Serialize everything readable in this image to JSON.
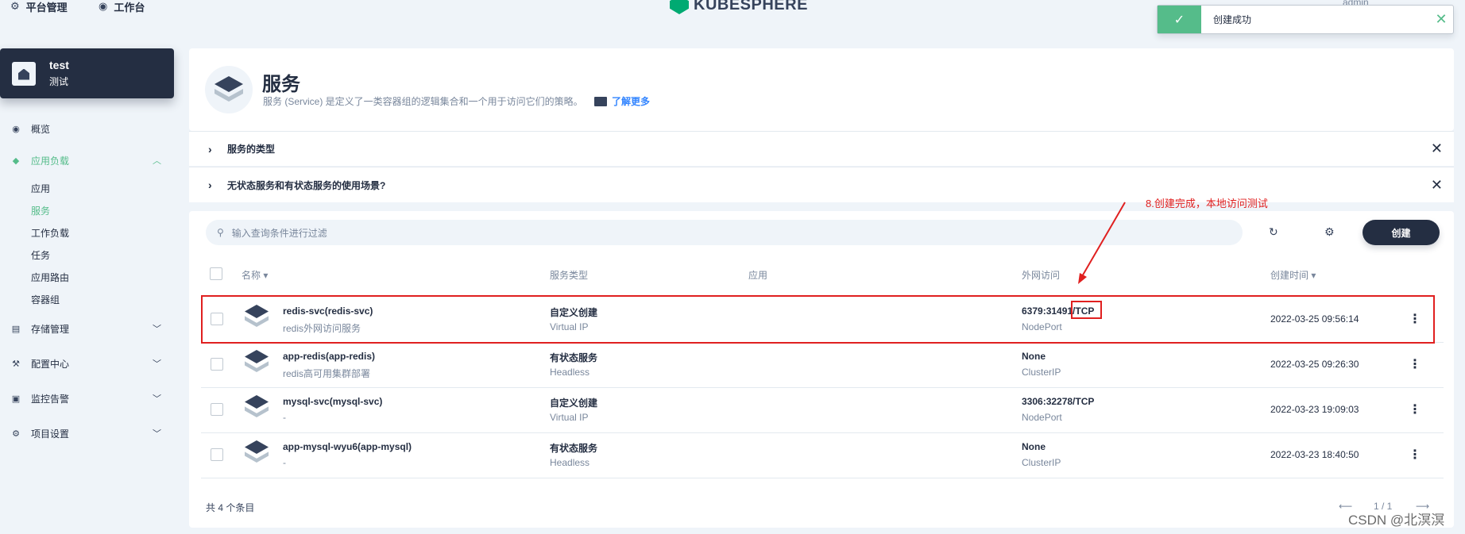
{
  "topbar": {
    "platform_label": "平台管理",
    "workbench_label": "工作台",
    "logo_text": "KUBESPHERE",
    "user": "admin"
  },
  "toast": {
    "message": "创建成功",
    "color": "#55bc8a"
  },
  "project": {
    "name": "test",
    "alias": "测试"
  },
  "sidebar": {
    "items": [
      {
        "label": "概览",
        "icon": "overview-icon"
      },
      {
        "label": "应用负载",
        "icon": "layers-icon"
      },
      {
        "label": "存储管理",
        "icon": "storage-icon"
      },
      {
        "label": "配置中心",
        "icon": "hammer-icon"
      },
      {
        "label": "监控告警",
        "icon": "monitor-icon"
      },
      {
        "label": "项目设置",
        "icon": "gear-icon"
      }
    ],
    "workload_sub": [
      "应用",
      "服务",
      "工作负载",
      "任务",
      "应用路由",
      "容器组"
    ]
  },
  "header": {
    "title": "服务",
    "description": "服务 (Service) 是定义了一类容器组的逻辑集合和一个用于访问它们的策略。",
    "learn_more": "了解更多"
  },
  "faq": [
    "服务的类型",
    "无状态服务和有状态服务的使用场景?"
  ],
  "toolbar": {
    "search_placeholder": "输入查询条件进行过滤",
    "create_label": "创建"
  },
  "table": {
    "columns": [
      "名称",
      "服务类型",
      "应用",
      "外网访问",
      "创建时间"
    ],
    "rows": [
      {
        "name": "redis-svc(redis-svc)",
        "desc": "redis外网访问服务",
        "type": "自定义创建",
        "ip": "Virtual IP",
        "port": "6379:31491/TCP",
        "ptype": "NodePort",
        "time": "2022-03-25 09:56:14"
      },
      {
        "name": "app-redis(app-redis)",
        "desc": "redis高可用集群部署",
        "type": "有状态服务",
        "ip": "Headless",
        "port": "None",
        "ptype": "ClusterIP",
        "time": "2022-03-25 09:26:30"
      },
      {
        "name": "mysql-svc(mysql-svc)",
        "desc": "-",
        "type": "自定义创建",
        "ip": "Virtual IP",
        "port": "3306:32278/TCP",
        "ptype": "NodePort",
        "time": "2022-03-23 19:09:03"
      },
      {
        "name": "app-mysql-wyu6(app-mysql)",
        "desc": "-",
        "type": "有状态服务",
        "ip": "Headless",
        "port": "None",
        "ptype": "ClusterIP",
        "time": "2022-03-23 18:40:50"
      }
    ],
    "total": "共 4 个条目",
    "page": "1 / 1"
  },
  "annotation": {
    "text": "8.创建完成，本地访问测试"
  },
  "watermark": "CSDN @北溟溟"
}
